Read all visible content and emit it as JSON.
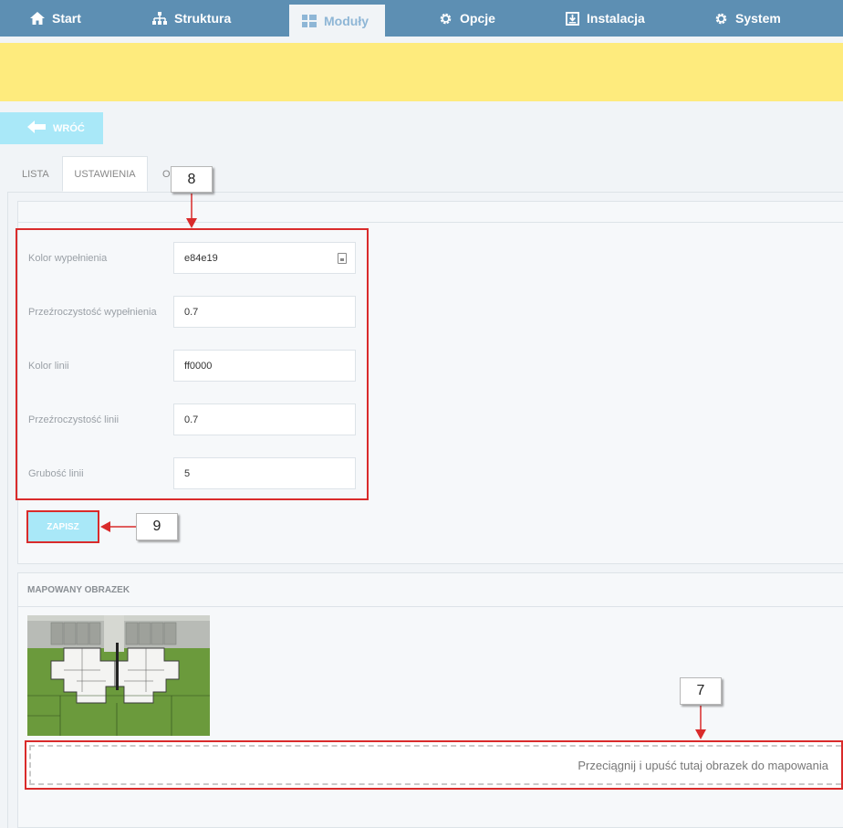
{
  "nav": {
    "items": [
      {
        "label": "Start",
        "icon": "home-icon"
      },
      {
        "label": "Struktura",
        "icon": "sitemap-icon"
      },
      {
        "label": "Moduły",
        "icon": "modules-icon"
      },
      {
        "label": "Opcje",
        "icon": "gear-icon"
      },
      {
        "label": "Instalacja",
        "icon": "install-icon"
      },
      {
        "label": "System",
        "icon": "gear-icon"
      }
    ],
    "active": "Moduły"
  },
  "back_button": {
    "label": "WRÓĆ",
    "icon": "arrow-left-icon"
  },
  "tabs": [
    {
      "label": "LISTA"
    },
    {
      "label": "USTAWIENIA"
    },
    {
      "label": "O"
    }
  ],
  "settings": {
    "fields": [
      {
        "label": "Kolor wypełnienia",
        "value": "e84e19",
        "icon": "color-picker-icon"
      },
      {
        "label": "Przeźroczystość wypełnienia",
        "value": "0.7"
      },
      {
        "label": "Kolor linii",
        "value": "ff0000"
      },
      {
        "label": "Przeźroczystość linii",
        "value": "0.7"
      },
      {
        "label": "Grubość linii",
        "value": "5"
      }
    ],
    "save_label": "ZAPISZ"
  },
  "mapped_image": {
    "heading": "MAPOWANY OBRAZEK",
    "dropzone_text": "Przeciągnij i upuść tutaj obrazek do mapowania"
  },
  "callouts": [
    "8",
    "9",
    "7"
  ],
  "colors": {
    "nav_bg": "#5d8fb3",
    "banner": "#feeb7d",
    "button": "#a9e8f8",
    "annotation_red": "#d92b2b"
  }
}
